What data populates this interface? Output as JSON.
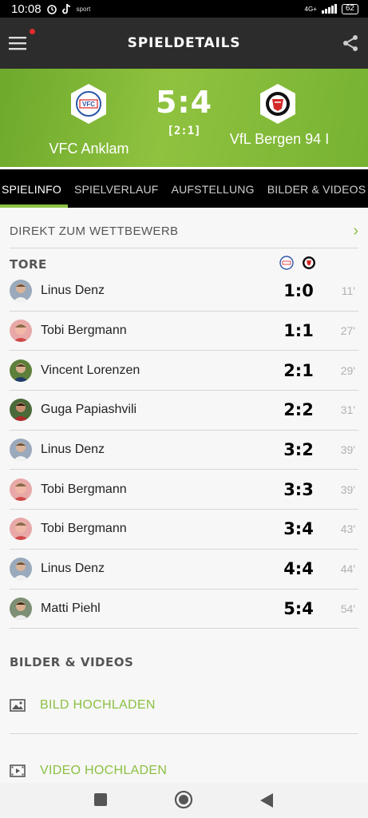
{
  "status": {
    "time": "10:08",
    "notification_small": "sport",
    "network": "4G+",
    "battery": "62"
  },
  "appbar": {
    "title": "SPIELDETAILS"
  },
  "match": {
    "score": "5:4",
    "halftime": "[2:1]",
    "home_team": "VFC Anklam",
    "away_team": "VfL Bergen 94 I",
    "home_logo_text": "VFC"
  },
  "tabs": [
    "SPIELINFO",
    "SPIELVERLAUF",
    "AUFSTELLUNG",
    "BILDER & VIDEOS"
  ],
  "direct": {
    "label": "DIREKT ZUM WETTBEWERB"
  },
  "goals_section": {
    "title": "TORE"
  },
  "goals": [
    {
      "player": "Linus Denz",
      "score": "1:0",
      "minute": "11'"
    },
    {
      "player": "Tobi Bergmann",
      "score": "1:1",
      "minute": "27'"
    },
    {
      "player": "Vincent Lorenzen",
      "score": "2:1",
      "minute": "29'"
    },
    {
      "player": "Guga Papiashvili",
      "score": "2:2",
      "minute": "31'"
    },
    {
      "player": "Linus Denz",
      "score": "3:2",
      "minute": "39'"
    },
    {
      "player": "Tobi Bergmann",
      "score": "3:3",
      "minute": "39'"
    },
    {
      "player": "Tobi Bergmann",
      "score": "3:4",
      "minute": "43'"
    },
    {
      "player": "Linus Denz",
      "score": "4:4",
      "minute": "44'"
    },
    {
      "player": "Matti Piehl",
      "score": "5:4",
      "minute": "54'"
    }
  ],
  "media": {
    "title": "BILDER & VIDEOS",
    "upload_image": "BILD HOCHLADEN",
    "upload_video": "VIDEO HOCHLADEN"
  },
  "colors": {
    "accent": "#8cc044",
    "appbar": "#2c2c2c",
    "hero_green": "#7cb534",
    "alert_dot": "#e32b2b"
  }
}
